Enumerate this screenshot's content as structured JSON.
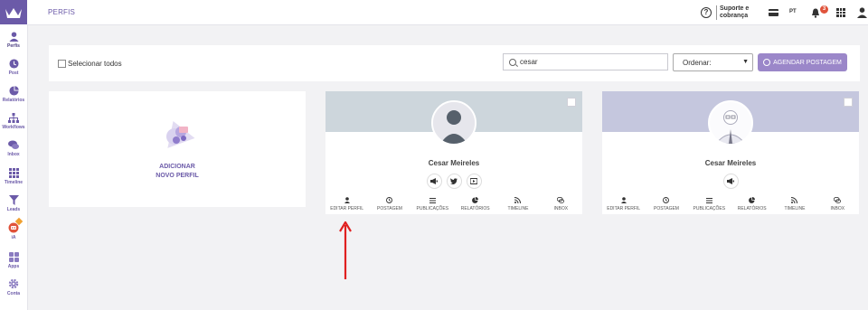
{
  "app": {
    "brand_color": "#6b5aa8",
    "accent_button_color": "#9b87c9",
    "logo_icon": "crown-icon"
  },
  "sidebar": {
    "items": [
      {
        "label": "Perfis",
        "icon": "user-icon",
        "active": true
      },
      {
        "label": "Post",
        "icon": "clock-icon"
      },
      {
        "label": "Relatórios",
        "icon": "pie-chart-icon"
      },
      {
        "label": "Workflows",
        "icon": "sitemap-icon"
      },
      {
        "label": "Inbox",
        "icon": "chat-icon"
      },
      {
        "label": "Timeline",
        "icon": "grid-icon"
      },
      {
        "label": "Leads",
        "icon": "filter-icon"
      },
      {
        "label": "iA",
        "icon": "robot-icon",
        "badge": "new"
      },
      {
        "label": "Apps",
        "icon": "apps-icon"
      },
      {
        "label": "Conta",
        "icon": "gear-icon"
      }
    ]
  },
  "header": {
    "title": "PERFIS",
    "support": "Suporte e cobrança",
    "language": "PT",
    "notifications_count": "3"
  },
  "toolbar": {
    "select_all_label": "Selecionar todos",
    "search_value": "cesar",
    "order_label": "Ordenar:",
    "schedule_label": "AGENDAR POSTAGEM"
  },
  "add_card": {
    "line1": "ADICIONAR",
    "line2": "NOVO PERFIL"
  },
  "actions": [
    "EDITAR PERFIL",
    "POSTAGEM",
    "PUBLICAÇÕES",
    "RELATÓRIOS",
    "TIMELINE",
    "INBOX"
  ],
  "profiles": [
    {
      "name": "Cesar Meireles",
      "cover_color": "#cdd6dc",
      "networks": [
        "megaphone-icon",
        "twitter-icon",
        "youtube-icon"
      ]
    },
    {
      "name": "Cesar Meireles",
      "cover_color": "#c5c7de",
      "networks": [
        "megaphone-icon"
      ]
    }
  ]
}
